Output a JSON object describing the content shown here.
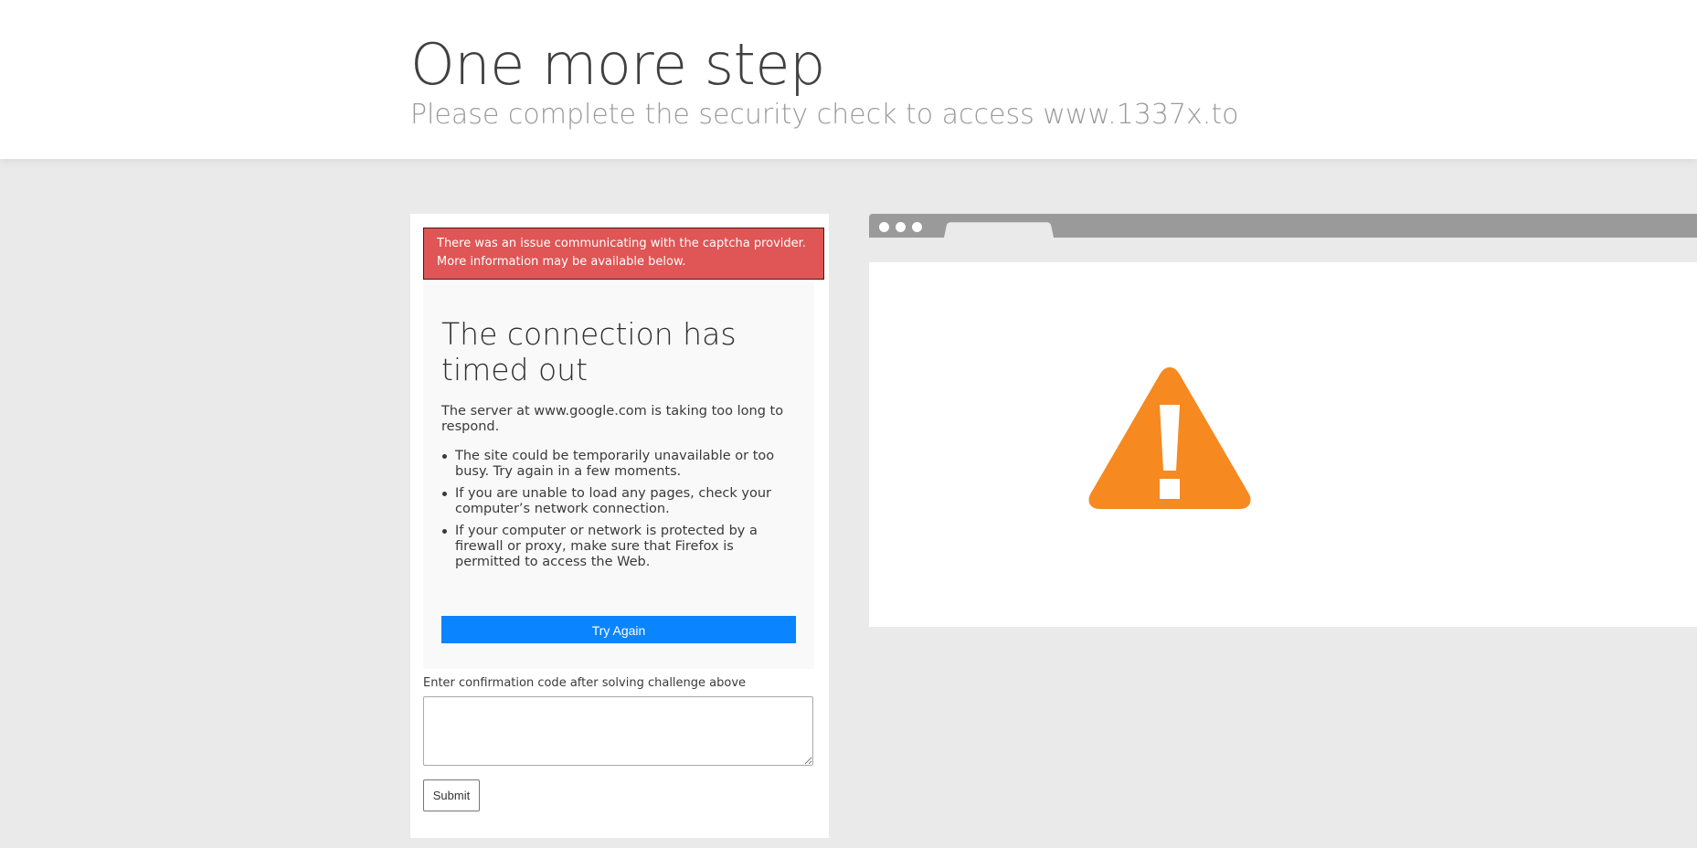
{
  "header": {
    "title": "One more step",
    "subtitle": "Please complete the security check to access www.1337x.to"
  },
  "alert": {
    "message": "There was an issue communicating with the captcha provider. More information may be available below."
  },
  "error_frame": {
    "title": "The connection has timed out",
    "description": "The server at www.google.com is taking too long to respond.",
    "suggestions": [
      "The site could be temporarily unavailable or too busy. Try again in a few moments.",
      "If you are unable to load any pages, check your computer’s network connection.",
      "If your computer or network is protected by a firewall or proxy, make sure that Firefox is permitted to access the Web."
    ],
    "try_again_label": "Try Again"
  },
  "form": {
    "confirm_label": "Enter confirmation code after solving challenge above",
    "confirm_value": "",
    "submit_label": "Submit"
  },
  "illustration": {
    "icon": "warning-triangle-icon",
    "icon_color": "#f6891f",
    "bar_color": "#9a9a9a"
  },
  "colors": {
    "alert_bg": "#e05555",
    "primary_button": "#0a84ff"
  }
}
